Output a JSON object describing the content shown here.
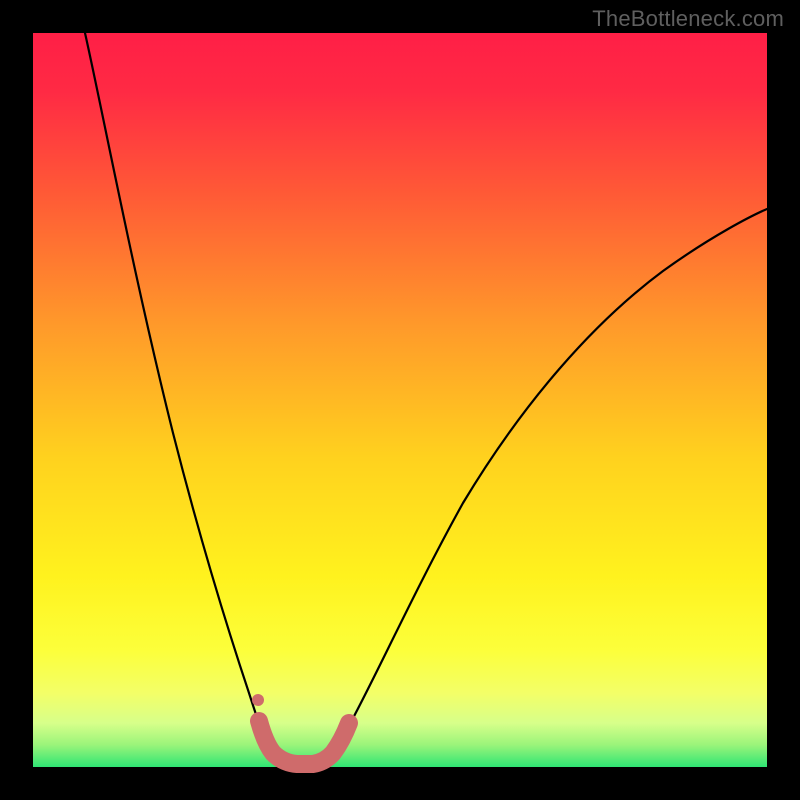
{
  "watermark": "TheBottleneck.com",
  "colors": {
    "background": "#000000",
    "gradient_top": "#ff2048",
    "gradient_mid_upper": "#ff7a2e",
    "gradient_mid": "#ffd22a",
    "gradient_mid_lower": "#fff82a",
    "gradient_lower": "#f3ff68",
    "gradient_bottom": "#2fe574",
    "curve": "#000000",
    "highlight": "#cf6b6b"
  },
  "chart_data": {
    "type": "line",
    "title": "",
    "xlabel": "",
    "ylabel": "",
    "x": [
      0,
      5,
      10,
      15,
      20,
      25,
      28,
      30,
      32,
      34,
      36,
      40,
      45,
      50,
      55,
      60,
      70,
      80,
      90,
      100
    ],
    "series": [
      {
        "name": "bottleneck-curve",
        "values": [
          100,
          88,
          77,
          65,
          52,
          37,
          24,
          12,
          3,
          0,
          1,
          6,
          18,
          30,
          40,
          48,
          58,
          65,
          70,
          74
        ]
      }
    ],
    "xlim": [
      0,
      100
    ],
    "ylim": [
      0,
      100
    ],
    "highlight": {
      "x_range": [
        29.5,
        38
      ],
      "y_range": [
        0,
        6
      ],
      "marker_point": {
        "x": 30,
        "y": 9
      }
    },
    "gradient_background": true,
    "grid": false,
    "legend": false
  }
}
